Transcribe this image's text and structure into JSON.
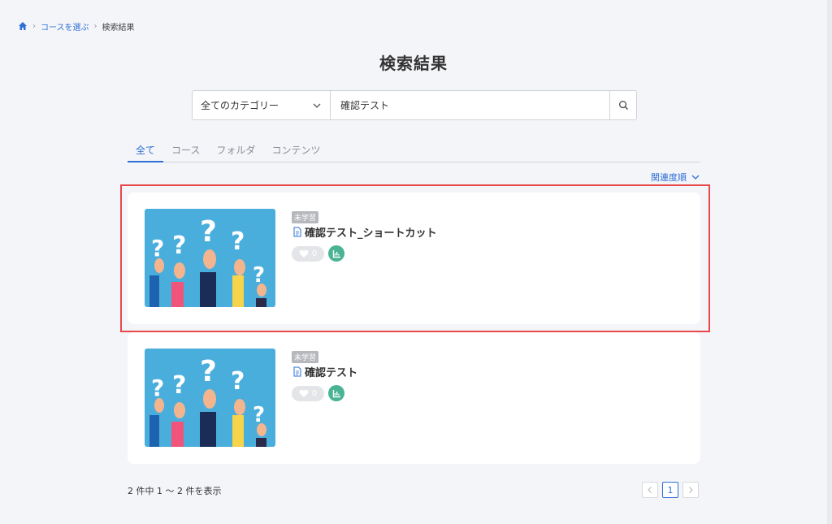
{
  "breadcrumb": {
    "home_icon": "home-icon",
    "course_select": "コースを選ぶ",
    "current": "検索結果"
  },
  "page": {
    "title": "検索結果"
  },
  "search": {
    "category": "全てのカテゴリー",
    "query": "確認テスト"
  },
  "tabs": [
    "全て",
    "コース",
    "フォルダ",
    "コンテンツ"
  ],
  "sort": {
    "label": "関連度順"
  },
  "results": [
    {
      "status": "未学習",
      "title": "確認テスト_ショートカット",
      "likes": "0"
    },
    {
      "status": "未学習",
      "title": "確認テスト",
      "likes": "0"
    }
  ],
  "summary": {
    "text": "2 件中 1 ～ 2 件を表示"
  },
  "pagination": {
    "current_page": "1"
  },
  "colors": {
    "accent": "#2e6fd6",
    "highlight": "#e8484b",
    "stats": "#4ab394",
    "thumb_bg": "#4aaedc"
  }
}
